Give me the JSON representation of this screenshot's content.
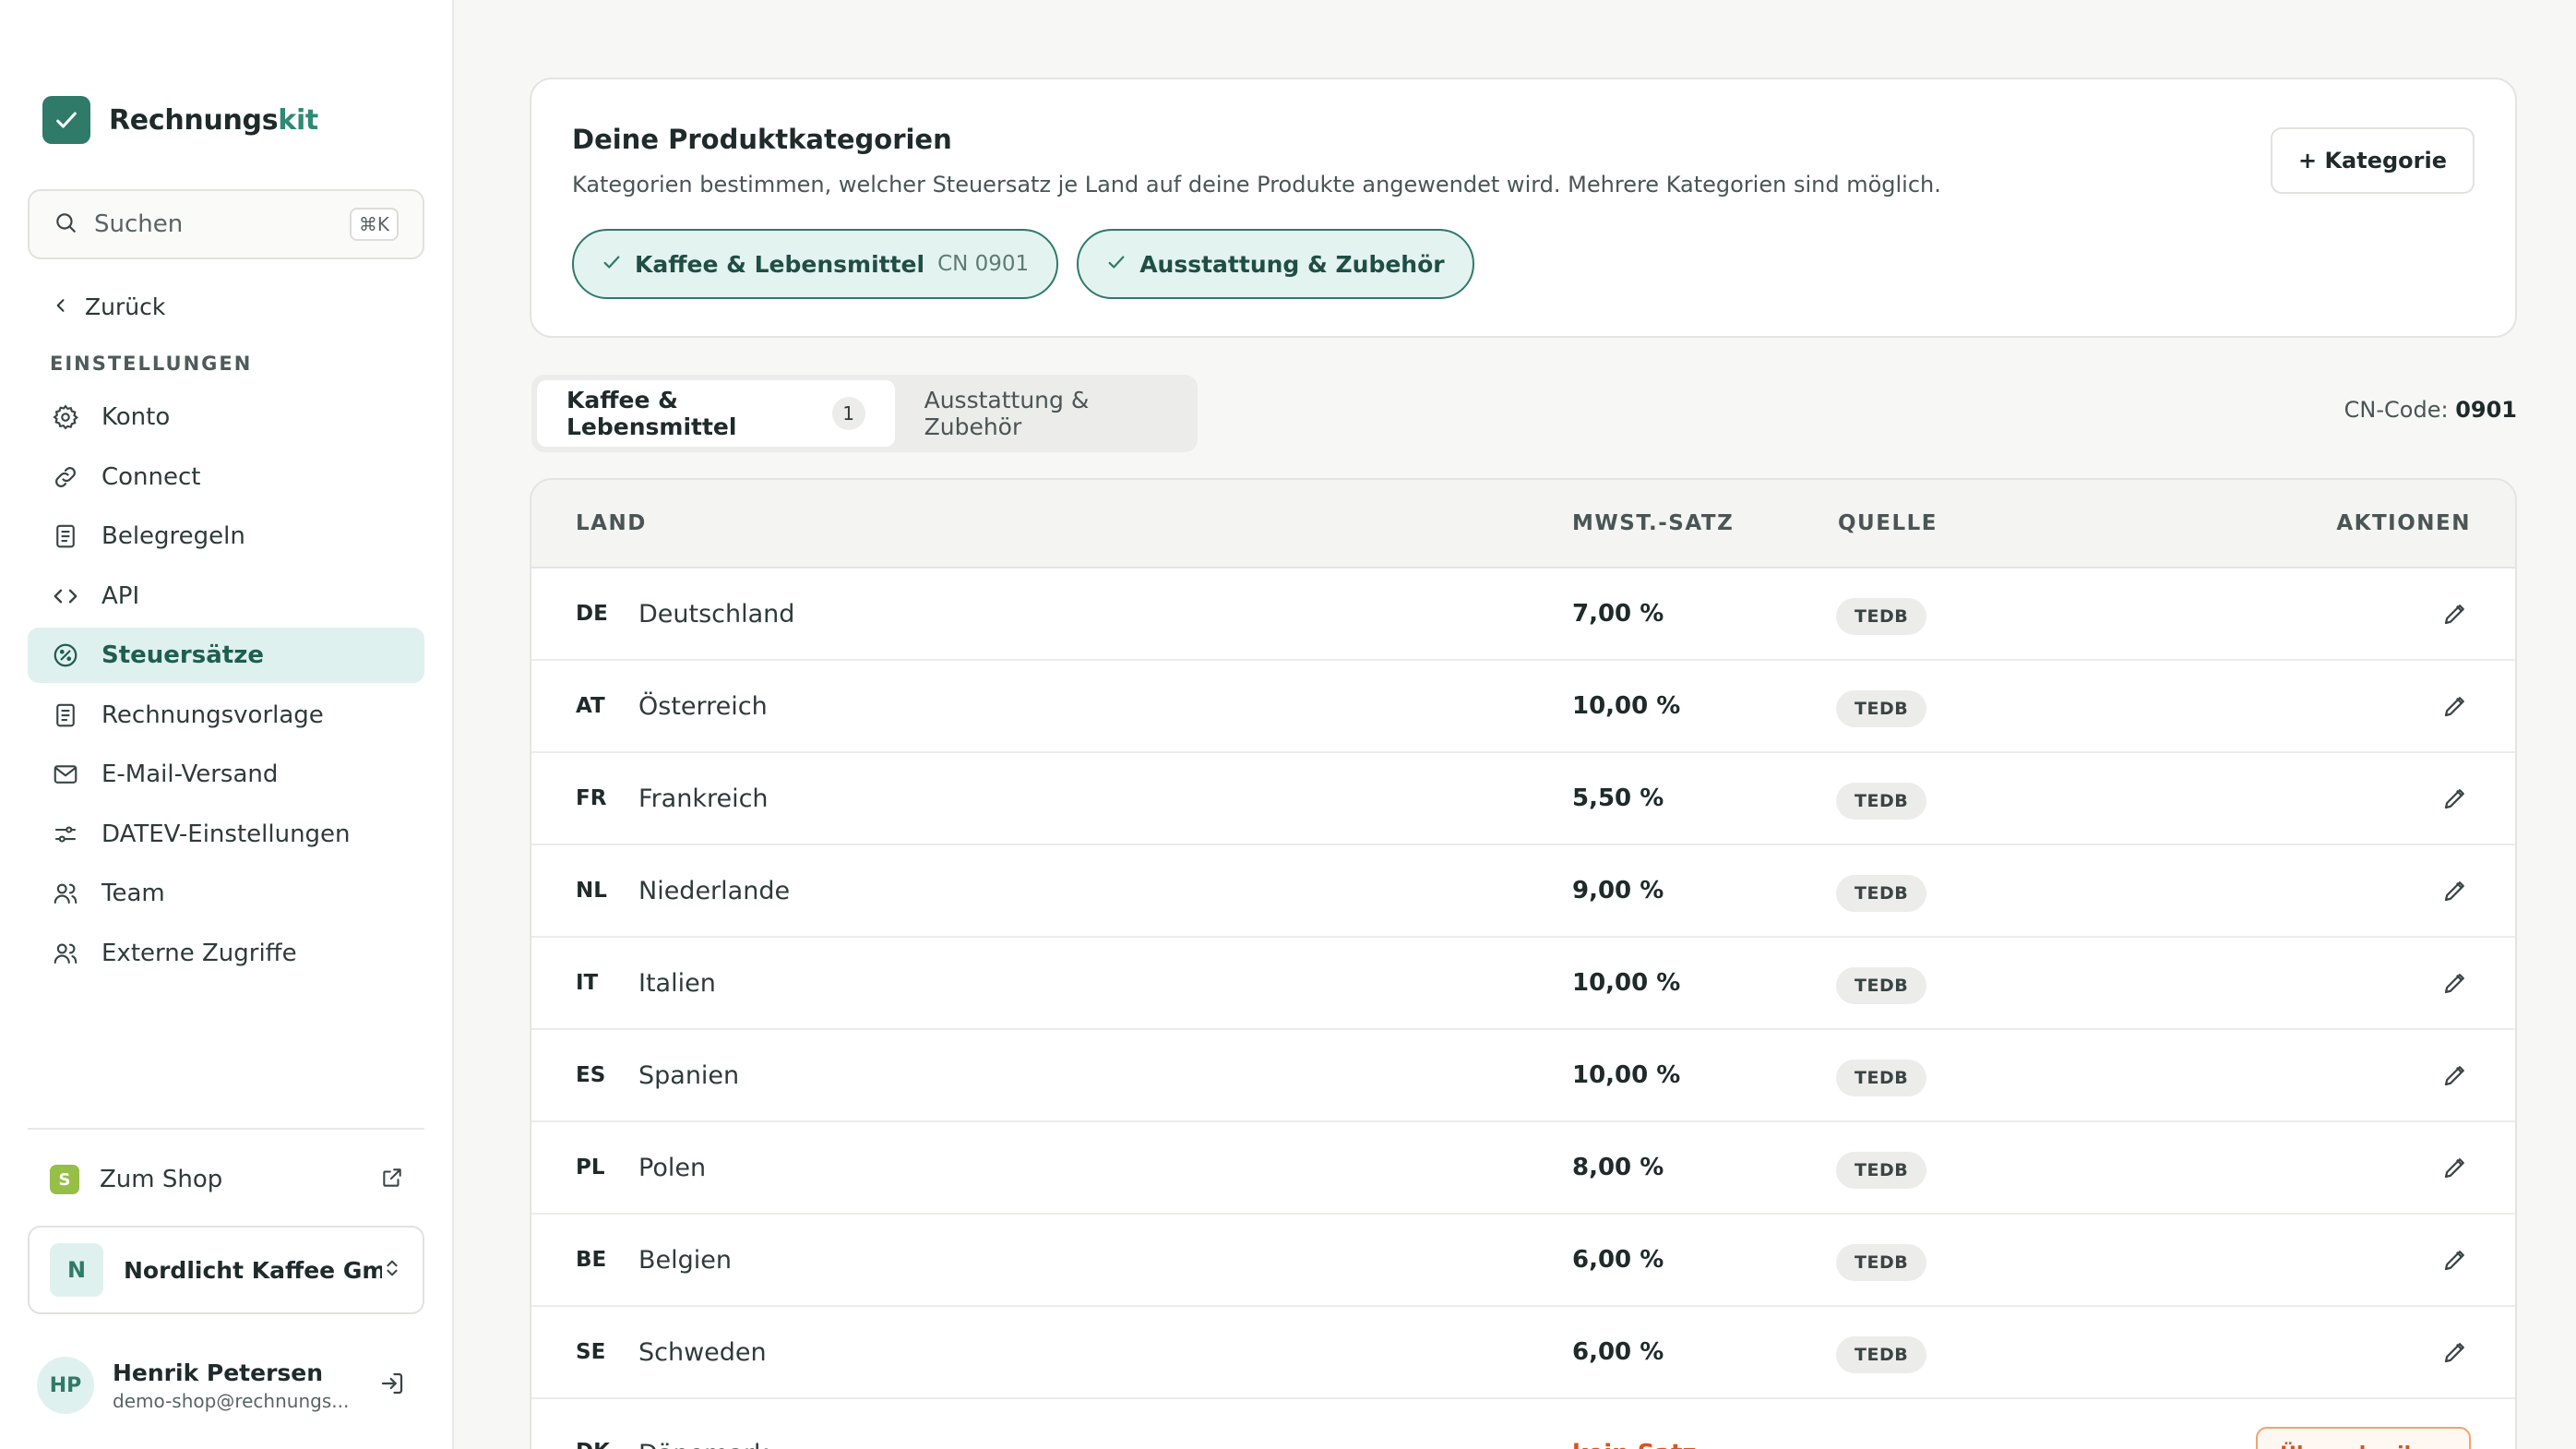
{
  "brand": {
    "name_main": "Rechnungs",
    "name_accent": "kit"
  },
  "search": {
    "placeholder": "Suchen",
    "shortcut": "⌘K"
  },
  "nav": {
    "back_label": "Zurück",
    "section_title": "EINSTELLUNGEN",
    "items": [
      {
        "label": "Konto",
        "icon": "gear-icon"
      },
      {
        "label": "Connect",
        "icon": "link-icon"
      },
      {
        "label": "Belegregeln",
        "icon": "document-icon"
      },
      {
        "label": "API",
        "icon": "code-icon"
      },
      {
        "label": "Steuersätze",
        "icon": "percent-icon",
        "active": true
      },
      {
        "label": "Rechnungsvorlage",
        "icon": "document-icon"
      },
      {
        "label": "E-Mail-Versand",
        "icon": "mail-icon"
      },
      {
        "label": "DATEV-Einstellungen",
        "icon": "sliders-icon"
      },
      {
        "label": "Team",
        "icon": "users-icon"
      },
      {
        "label": "Externe Zugriffe",
        "icon": "users-icon"
      }
    ]
  },
  "footer": {
    "shop_badge": "S",
    "shop_label": "Zum Shop",
    "company_initial": "N",
    "company_name": "Nordlicht Kaffee Gm...",
    "user_initials": "HP",
    "user_name": "Henrik Petersen",
    "user_email": "demo-shop@rechnungs..."
  },
  "categories_card": {
    "title": "Deine Produktkategorien",
    "description": "Kategorien bestimmen, welcher Steuersatz je Land auf deine Produkte angewendet wird. Mehrere Kategorien sind möglich.",
    "add_button": "+ Kategorie",
    "chips": [
      {
        "label": "Kaffee & Lebensmittel",
        "code": "CN 0901"
      },
      {
        "label": "Ausstattung & Zubehör",
        "code": ""
      }
    ]
  },
  "tabs": [
    {
      "label": "Kaffee & Lebensmittel",
      "count": "1",
      "active": true
    },
    {
      "label": "Ausstattung & Zubehör",
      "active": false
    }
  ],
  "cn_code": {
    "label": "CN-Code:",
    "value": "0901"
  },
  "table": {
    "headers": {
      "land": "LAND",
      "rate": "MWST.-SATZ",
      "source": "QUELLE",
      "actions": "AKTIONEN"
    },
    "rows": [
      {
        "code": "DE",
        "country": "Deutschland",
        "rate": "7,00 %",
        "source": "TEDB"
      },
      {
        "code": "AT",
        "country": "Österreich",
        "rate": "10,00 %",
        "source": "TEDB"
      },
      {
        "code": "FR",
        "country": "Frankreich",
        "rate": "5,50 %",
        "source": "TEDB"
      },
      {
        "code": "NL",
        "country": "Niederlande",
        "rate": "9,00 %",
        "source": "TEDB"
      },
      {
        "code": "IT",
        "country": "Italien",
        "rate": "10,00 %",
        "source": "TEDB"
      },
      {
        "code": "ES",
        "country": "Spanien",
        "rate": "10,00 %",
        "source": "TEDB"
      },
      {
        "code": "PL",
        "country": "Polen",
        "rate": "8,00 %",
        "source": "TEDB"
      },
      {
        "code": "BE",
        "country": "Belgien",
        "rate": "6,00 %",
        "source": "TEDB"
      },
      {
        "code": "SE",
        "country": "Schweden",
        "rate": "6,00 %",
        "source": "TEDB"
      }
    ],
    "partial_row": {
      "code": "DK",
      "country": "Dänemark",
      "rate": "kein Satz",
      "action": "Überschreiben"
    }
  },
  "colors": {
    "accent": "#2f7a68",
    "active_bg": "#dff1ee",
    "warning": "#d9541e"
  }
}
